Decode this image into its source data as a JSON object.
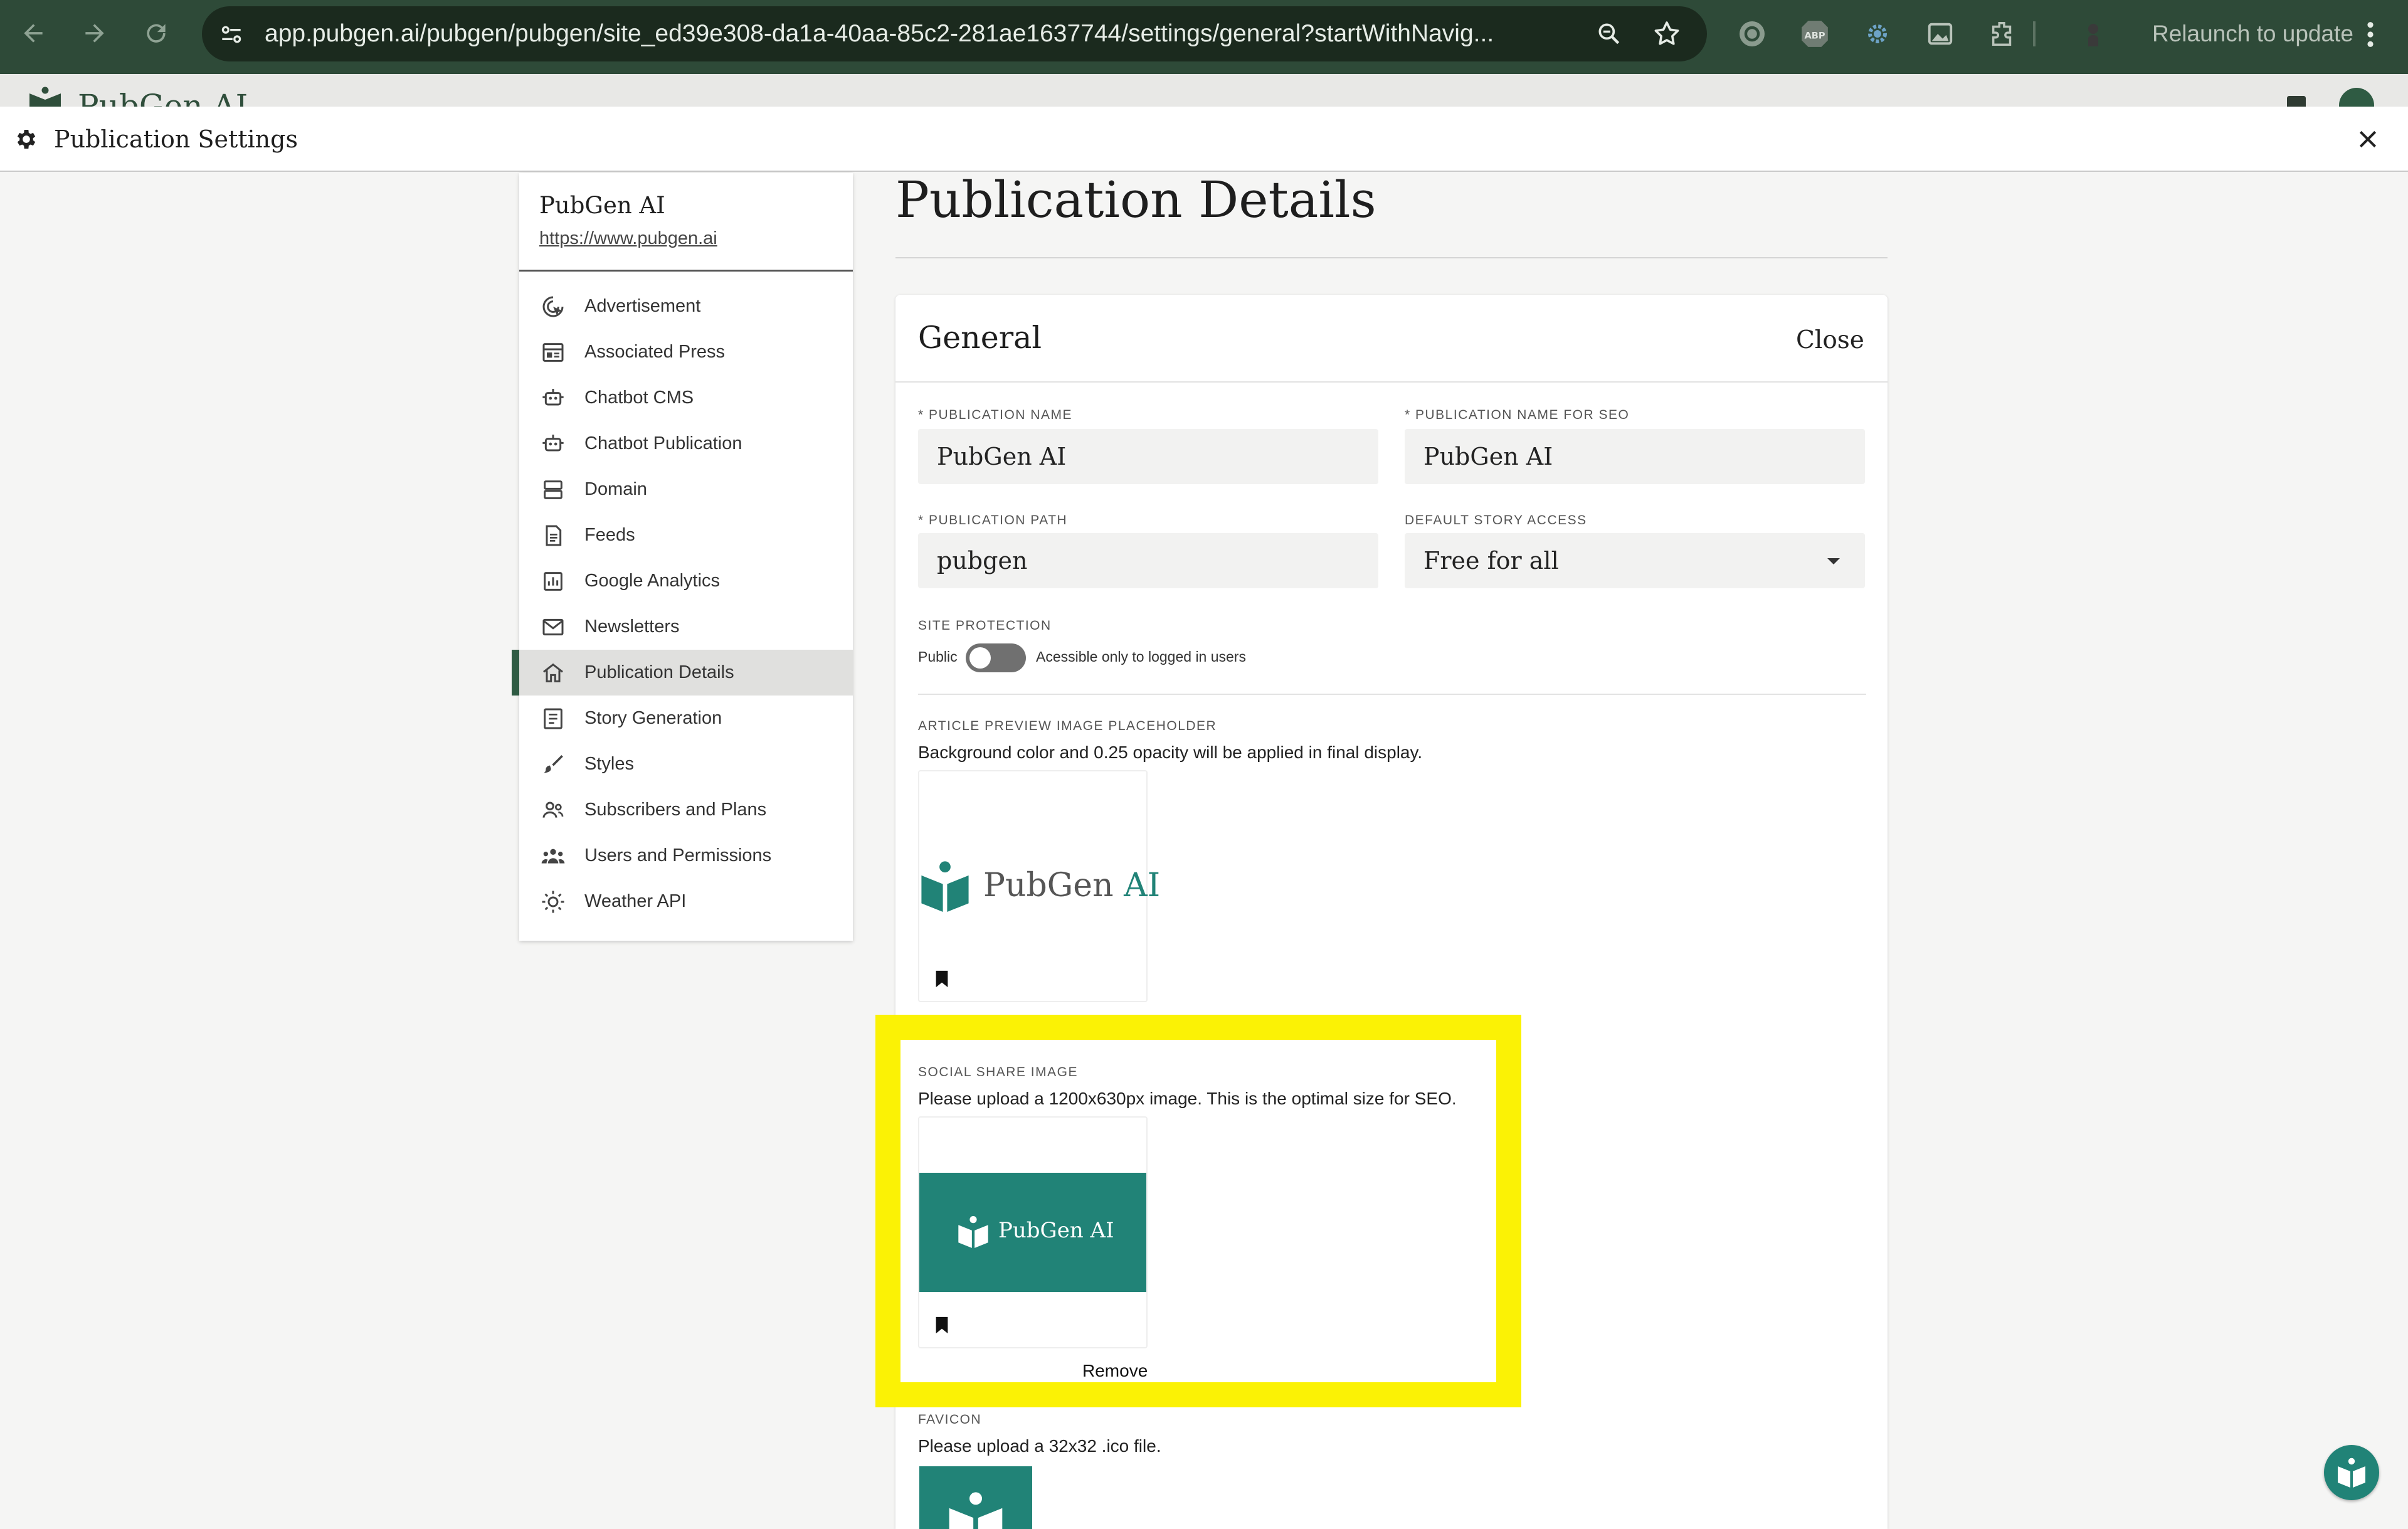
{
  "browser": {
    "url": "app.pubgen.ai/pubgen/pubgen/site_ed39e308-da1a-40aa-85c2-281ae1637744/settings/general?startWithNavig...",
    "relaunch_label": "Relaunch to update",
    "extensions": [
      "google-lens-icon",
      "adblock-plus-icon",
      "gear-extension-icon",
      "image-extension-icon",
      "puzzle-extensions-icon",
      "profile-avatar-icon"
    ]
  },
  "behind_page": {
    "logo_text": "PubGen AI"
  },
  "dialog": {
    "title": "Publication Settings"
  },
  "sidebar": {
    "pub_name": "PubGen AI",
    "pub_url": "https://www.pubgen.ai",
    "items": [
      {
        "label": "Advertisement",
        "icon": "ad-target-icon"
      },
      {
        "label": "Associated Press",
        "icon": "newspaper-icon"
      },
      {
        "label": "Chatbot CMS",
        "icon": "robot-icon"
      },
      {
        "label": "Chatbot Publication",
        "icon": "robot-icon"
      },
      {
        "label": "Domain",
        "icon": "server-icon"
      },
      {
        "label": "Feeds",
        "icon": "document-icon"
      },
      {
        "label": "Google Analytics",
        "icon": "analytics-chart-icon"
      },
      {
        "label": "Newsletters",
        "icon": "mail-icon"
      },
      {
        "label": "Publication Details",
        "icon": "home-icon",
        "active": true
      },
      {
        "label": "Story Generation",
        "icon": "list-document-icon"
      },
      {
        "label": "Styles",
        "icon": "brush-icon"
      },
      {
        "label": "Subscribers and Plans",
        "icon": "people-icon"
      },
      {
        "label": "Users and Permissions",
        "icon": "group-icon"
      },
      {
        "label": "Weather API",
        "icon": "sun-icon"
      }
    ]
  },
  "page": {
    "title": "Publication Details"
  },
  "card": {
    "title": "General",
    "close_label": "Close",
    "fields": {
      "publication_name": {
        "label": "* PUBLICATION NAME",
        "value": "PubGen AI"
      },
      "publication_name_seo": {
        "label": "* PUBLICATION NAME FOR SEO",
        "value": "PubGen AI"
      },
      "publication_path": {
        "label": "* PUBLICATION PATH",
        "value": "pubgen"
      },
      "default_story_access": {
        "label": "DEFAULT STORY ACCESS",
        "value": "Free for all"
      }
    },
    "site_protection": {
      "label": "SITE PROTECTION",
      "left_label": "Public",
      "right_label": "Acessible only to logged in users",
      "enabled": false
    },
    "article_preview": {
      "label": "ARTICLE PREVIEW IMAGE PLACEHOLDER",
      "helper": "Background color and 0.25 opacity will be applied in final display.",
      "logo_text_a": "PubGen",
      "logo_text_b": "AI"
    },
    "social_share": {
      "label": "SOCIAL SHARE IMAGE",
      "helper": "Please upload a 1200x630px image. This is the optimal size for SEO.",
      "logo_text": "PubGen AI",
      "remove_label": "Remove"
    },
    "favicon": {
      "label": "FAVICON",
      "helper": "Please upload a 32x32 .ico file."
    }
  },
  "colors": {
    "brand_teal": "#218377",
    "brand_dark_green": "#2f4e3b",
    "highlight_yellow": "#fbf205",
    "chrome_green": "#2e4a38"
  }
}
